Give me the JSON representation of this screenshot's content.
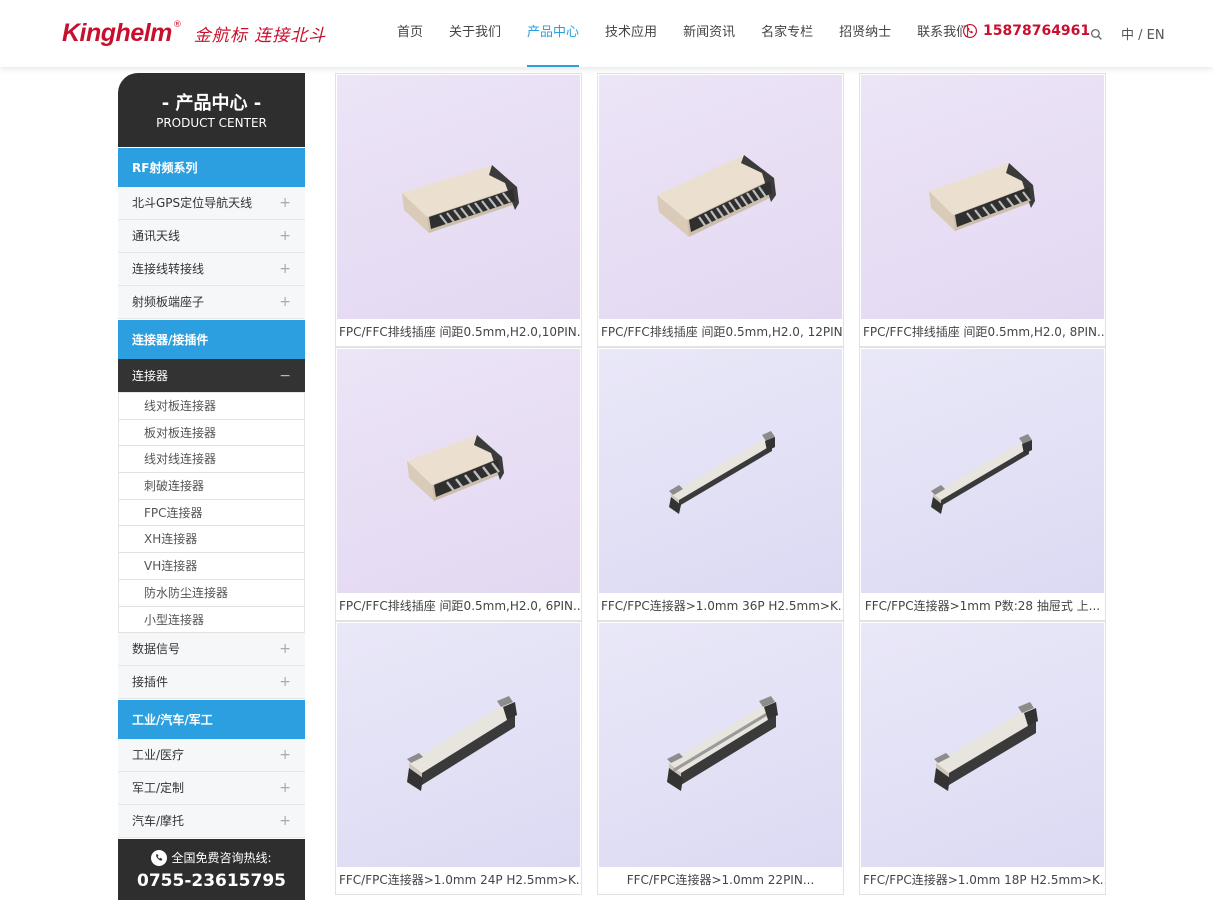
{
  "header": {
    "logo_brand": "Kinghelm",
    "logo_reg": "®",
    "logo_slogan": "金航标 连接北斗",
    "nav": [
      "首页",
      "关于我们",
      "产品中心",
      "技术应用",
      "新闻资讯",
      "名家专栏",
      "招贤纳士",
      "联系我们"
    ],
    "active_nav": "产品中心",
    "phone": "15878764961",
    "lang": "中 / EN"
  },
  "sidebar": {
    "title_cn": "- 产品中心 -",
    "title_en": "PRODUCT CENTER",
    "cat1": "RF射频系列",
    "cat1_items": [
      "北斗GPS定位导航天线",
      "通讯天线",
      "连接线转接线",
      "射频板端座子"
    ],
    "cat2": "连接器/接插件",
    "open_item": "连接器",
    "open_subs": [
      "线对板连接器",
      "板对板连接器",
      "线对线连接器",
      "刺破连接器",
      "FPC连接器",
      "XH连接器",
      "VH连接器",
      "防水防尘连接器",
      "小型连接器"
    ],
    "cat2_items": [
      "数据信号",
      "接插件"
    ],
    "cat3": "工业/汽车/军工",
    "cat3_items": [
      "工业/医疗",
      "军工/定制",
      "汽车/摩托"
    ],
    "plus": "+",
    "minus": "−",
    "hotline_label": "全国免费咨询热线:",
    "hotline_number": "0755-23615795"
  },
  "products": [
    {
      "caption": "FPC/FFC排线插座 间距0.5mm,H2.0,10PIN..."
    },
    {
      "caption": "FPC/FFC排线插座 间距0.5mm,H2.0, 12PIN..."
    },
    {
      "caption": "FPC/FFC排线插座 间距0.5mm,H2.0, 8PIN..."
    },
    {
      "caption": "FPC/FFC排线插座 间距0.5mm,H2.0, 6PIN..."
    },
    {
      "caption": "FFC/FPC连接器>1.0mm 36P H2.5mm>K..."
    },
    {
      "caption": "FFC/FPC连接器>1mm P数:28 抽屉式 上..."
    },
    {
      "caption": "FFC/FPC连接器>1.0mm 24P H2.5mm>K..."
    },
    {
      "caption": "FFC/FPC连接器>1.0mm 22PIN..."
    },
    {
      "caption": "FFC/FPC连接器>1.0mm 18P H2.5mm>K..."
    }
  ],
  "colors": {
    "brand_red": "#c8102e",
    "accent_blue": "#2c9fe0",
    "dark": "#2e2e2e"
  }
}
